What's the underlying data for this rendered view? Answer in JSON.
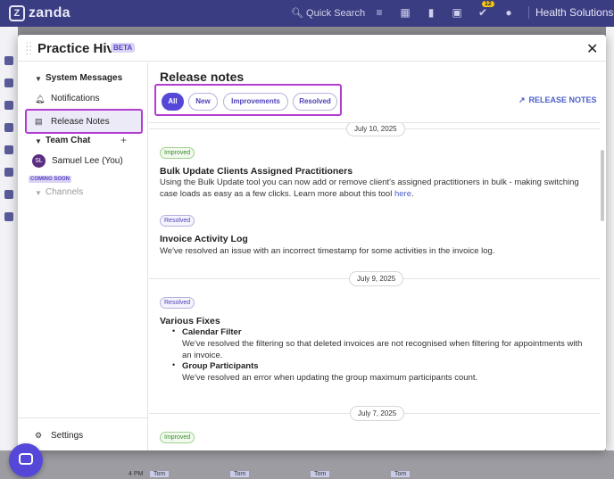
{
  "app": {
    "brand": "zanda",
    "search_placeholder": "Quick Search",
    "notification_badge": "12",
    "organization": "Health Solutions"
  },
  "modal": {
    "title": "Practice Hive",
    "beta_label": "BETA"
  },
  "sidebar": {
    "system_messages": "System Messages",
    "notifications": "Notifications",
    "release_notes": "Release Notes",
    "team_chat": "Team Chat",
    "user_initials": "SL",
    "user_name": "Samuel Lee (You)",
    "coming_soon": "COMING SOON",
    "channels": "Channels",
    "settings": "Settings"
  },
  "main": {
    "title": "Release notes",
    "filters": [
      "All",
      "New",
      "Improvements",
      "Resolved"
    ],
    "active_filter": "All",
    "release_notes_link": "RELEASE NOTES"
  },
  "feed": [
    {
      "date": "July 10, 2025",
      "entries": [
        {
          "tag": "Improved",
          "title": "Bulk Update Clients Assigned Practitioners",
          "body": "Using the Bulk Update tool you can now add or remove client's assigned practitioners in bulk - making switching case loads as easy as a few clicks. Learn more about this tool",
          "link_text": "here",
          "link_suffix": "."
        },
        {
          "tag": "Resolved",
          "title": "Invoice Activity Log",
          "body": "We've resolved an issue with an incorrect timestamp for some activities in the invoice log."
        }
      ]
    },
    {
      "date": "July 9, 2025",
      "entries": [
        {
          "tag": "Resolved",
          "title": "Various Fixes",
          "bullets": [
            {
              "title": "Calendar Filter",
              "body": "We've resolved the filtering so that deleted invoices are not recognised when filtering for appointments with an invoice."
            },
            {
              "title": "Group Participants",
              "body": "We've resolved an error when updating the group maximum participants count."
            }
          ]
        }
      ]
    },
    {
      "date": "July 7, 2025",
      "entries": [
        {
          "tag": "Improved"
        }
      ]
    }
  ],
  "background_calendar": {
    "time": "4 PM",
    "event_labels": [
      "Tom",
      "Tom",
      "Tom",
      "Tom"
    ]
  },
  "colors": {
    "topbar": "#3b3d82",
    "accent": "#5548d9",
    "highlight_outline": "#b23ed0",
    "improved_tag": "#3b8a2e",
    "resolved_tag": "#4d41b8"
  }
}
